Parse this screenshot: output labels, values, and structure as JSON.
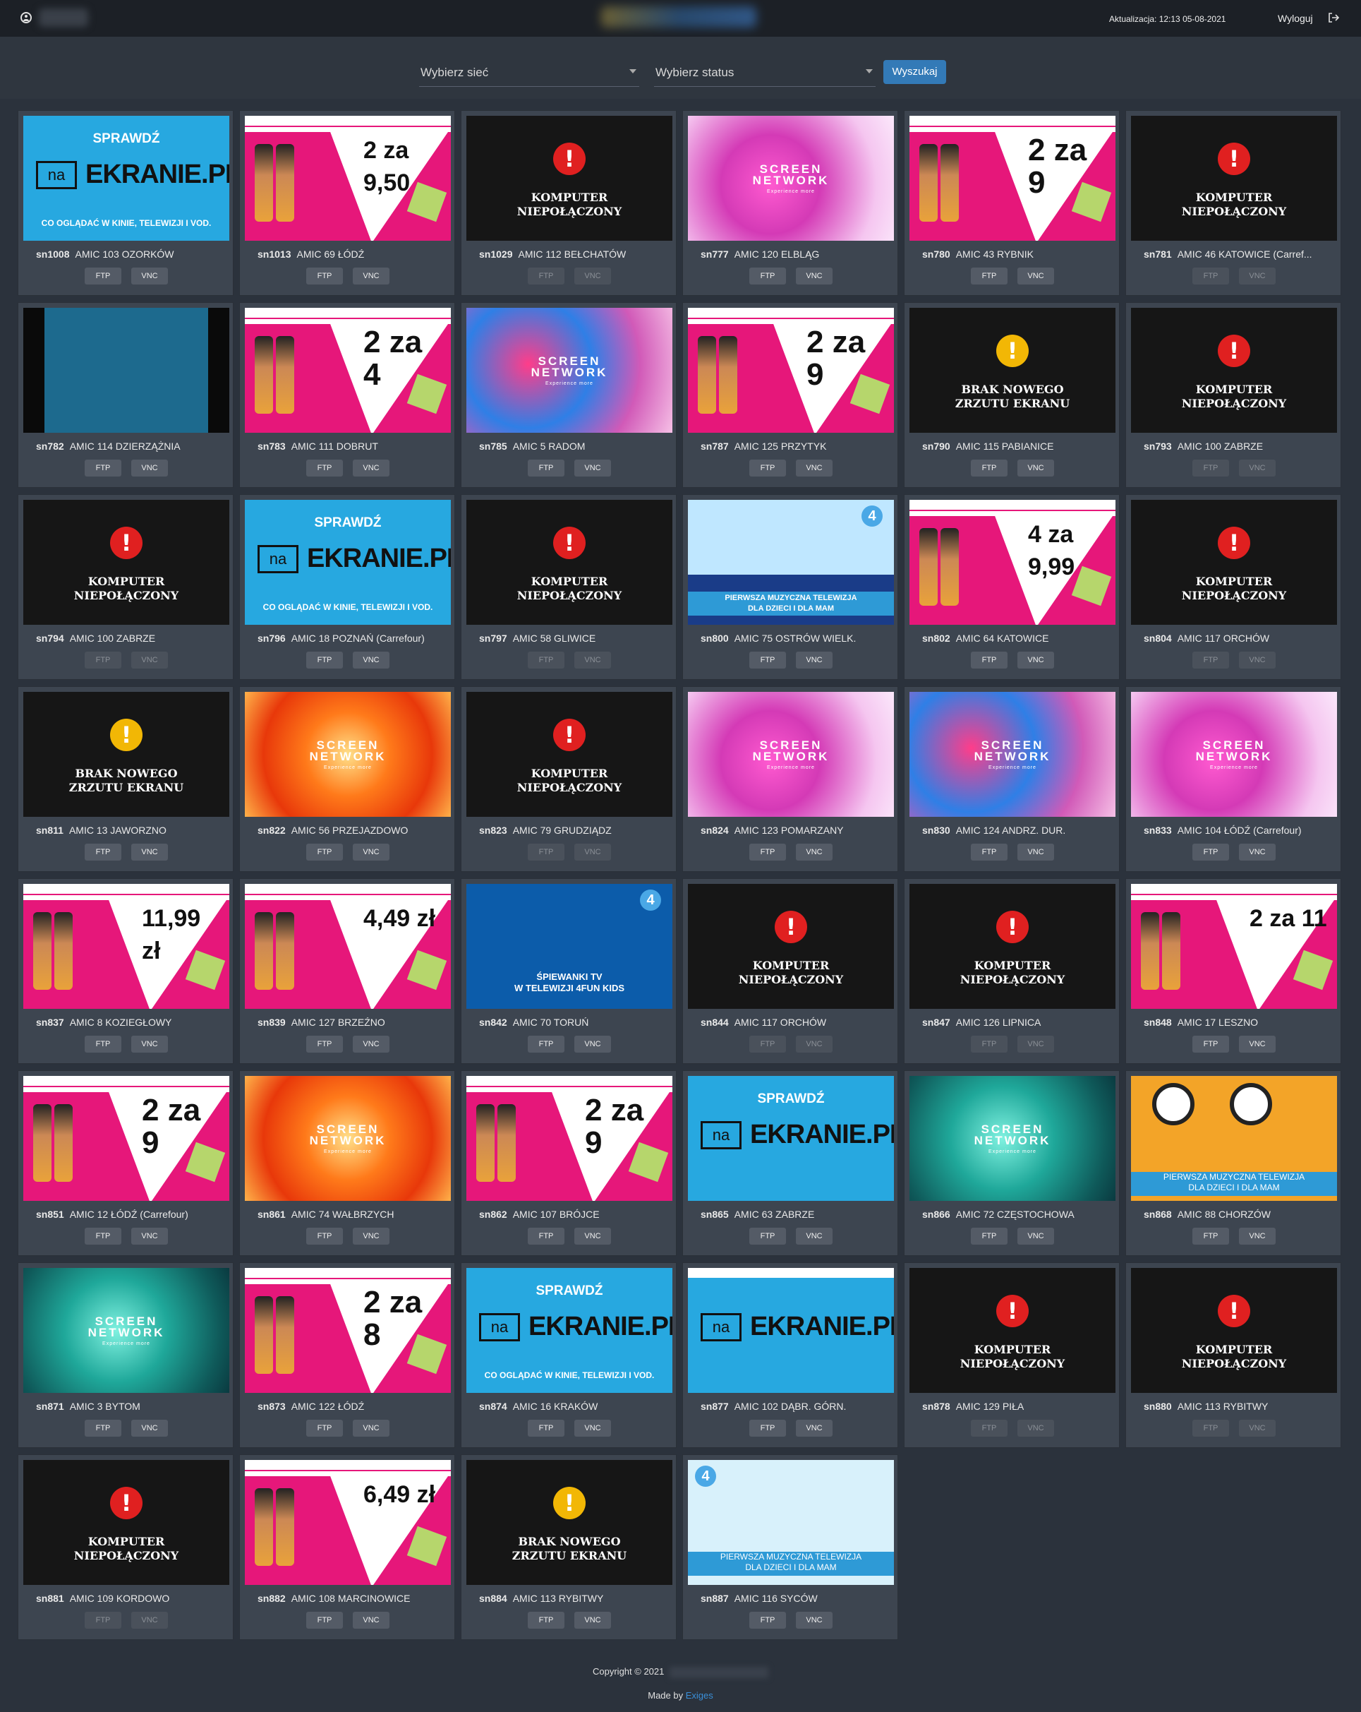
{
  "header": {
    "update_label": "Aktualizacja: 12:13 05-08-2021",
    "logout_label": "Wyloguj"
  },
  "filters": {
    "network_placeholder": "Wybierz sieć",
    "status_placeholder": "Wybierz status",
    "search_label": "Wyszukaj"
  },
  "buttons": {
    "ftp": "FTP",
    "vnc": "VNC"
  },
  "thumb_texts": {
    "disconnected": [
      "KOMPUTER",
      "NIEPOŁĄCZONY"
    ],
    "no_screenshot": [
      "BRAK NOWEGO",
      "ZRZUTU EKRANU"
    ],
    "ekranie_top": "SPRAWDŹ",
    "ekranie_na": "na",
    "ekranie_main": "EKRANIE.PL",
    "ekranie_bottom": "CO OGLĄDAĆ W KINIE, TELEWIZJI I VOD.",
    "screen_network": "SCREEN",
    "screen_network2": "NETWORK",
    "screen_network3": "Experience more",
    "fun_music": [
      "PIERWSZA MUZYCZNA TELEWIZJA",
      "DLA DZIECI I DLA MAM"
    ],
    "fun_songs": [
      "ŚPIEWANKI TV",
      "W TELEWIZJI 4FUN KIDS"
    ],
    "exclaim": "!",
    "four": "4"
  },
  "screens": [
    {
      "id": "sn1008",
      "name": "AMIC 103 OZORKÓW",
      "thumb": "ekranie",
      "dim": false
    },
    {
      "id": "sn1013",
      "name": "AMIC 69 ŁÓDŹ",
      "thumb": "promo",
      "dim": false,
      "promo": "2 za 9,50"
    },
    {
      "id": "sn1029",
      "name": "AMIC 112 BEŁCHATÓW",
      "thumb": "disconnected",
      "dim": true
    },
    {
      "id": "sn777",
      "name": "AMIC 120 ELBLĄG",
      "thumb": "smoke-pink",
      "dim": false
    },
    {
      "id": "sn780",
      "name": "AMIC 43 RYBNIK",
      "thumb": "promo",
      "dim": false,
      "promo": "2 za 9"
    },
    {
      "id": "sn781",
      "name": "AMIC 46 KATOWICE (Carref...",
      "thumb": "disconnected",
      "dim": true
    },
    {
      "id": "sn782",
      "name": "AMIC 114 DZIERZĄŻNIA",
      "thumb": "dark",
      "dim": false
    },
    {
      "id": "sn783",
      "name": "AMIC 111 DOBRUT",
      "thumb": "promo",
      "dim": false,
      "promo": "2 za 4"
    },
    {
      "id": "sn785",
      "name": "AMIC 5 RADOM",
      "thumb": "smoke-blue",
      "dim": false
    },
    {
      "id": "sn787",
      "name": "AMIC 125 PRZYTYK",
      "thumb": "promo",
      "dim": false,
      "promo": "2 za 9"
    },
    {
      "id": "sn790",
      "name": "AMIC 115 PABIANICE",
      "thumb": "noshot",
      "dim": false
    },
    {
      "id": "sn793",
      "name": "AMIC 100 ZABRZE",
      "thumb": "disconnected",
      "dim": true
    },
    {
      "id": "sn794",
      "name": "AMIC 100 ZABRZE",
      "thumb": "disconnected",
      "dim": true
    },
    {
      "id": "sn796",
      "name": "AMIC 18 POZNAŃ (Carrefour)",
      "thumb": "ekranie",
      "dim": false
    },
    {
      "id": "sn797",
      "name": "AMIC 58 GLIWICE",
      "thumb": "disconnected",
      "dim": true
    },
    {
      "id": "sn800",
      "name": "AMIC 75 OSTRÓW WIELK.",
      "thumb": "4fun-sea",
      "dim": false
    },
    {
      "id": "sn802",
      "name": "AMIC 64 KATOWICE",
      "thumb": "promo",
      "dim": false,
      "promo": "4 za 9,99"
    },
    {
      "id": "sn804",
      "name": "AMIC 117 ORCHÓW",
      "thumb": "disconnected",
      "dim": true
    },
    {
      "id": "sn811",
      "name": "AMIC 13 JAWORZNO",
      "thumb": "noshot",
      "dim": false
    },
    {
      "id": "sn822",
      "name": "AMIC 56 PRZEJAZDOWO",
      "thumb": "smoke-orange",
      "dim": false
    },
    {
      "id": "sn823",
      "name": "AMIC 79 GRUDZIĄDZ",
      "thumb": "disconnected",
      "dim": true
    },
    {
      "id": "sn824",
      "name": "AMIC 123 POMARZANY",
      "thumb": "smoke-pink",
      "dim": false
    },
    {
      "id": "sn830",
      "name": "AMIC 124 ANDRZ. DUR.",
      "thumb": "smoke-blue",
      "dim": false
    },
    {
      "id": "sn833",
      "name": "AMIC 104 ŁÓDŹ (Carrefour)",
      "thumb": "smoke-pink",
      "dim": false
    },
    {
      "id": "sn837",
      "name": "AMIC 8 KOZIEGŁOWY",
      "thumb": "promo",
      "dim": false,
      "promo": "11,99 zł"
    },
    {
      "id": "sn839",
      "name": "AMIC 127 BRZEŹNO",
      "thumb": "promo",
      "dim": false,
      "promo": "4,49 zł"
    },
    {
      "id": "sn842",
      "name": "AMIC 70 TORUŃ",
      "thumb": "4fun-under",
      "dim": false
    },
    {
      "id": "sn844",
      "name": "AMIC 117 ORCHÓW",
      "thumb": "disconnected",
      "dim": true
    },
    {
      "id": "sn847",
      "name": "AMIC 126 LIPNICA",
      "thumb": "disconnected",
      "dim": true
    },
    {
      "id": "sn848",
      "name": "AMIC 17 LESZNO",
      "thumb": "promo",
      "dim": false,
      "promo": "2 za 11"
    },
    {
      "id": "sn851",
      "name": "AMIC 12 ŁÓDŹ (Carrefour)",
      "thumb": "promo",
      "dim": false,
      "promo": "2 za 9"
    },
    {
      "id": "sn861",
      "name": "AMIC 74 WAŁBRZYCH",
      "thumb": "smoke-orange",
      "dim": false
    },
    {
      "id": "sn862",
      "name": "AMIC 107 BRÓJCE",
      "thumb": "promo",
      "dim": false,
      "promo": "2 za 9"
    },
    {
      "id": "sn865",
      "name": "AMIC 63 ZABRZE",
      "thumb": "ekranie-nobottom",
      "dim": false
    },
    {
      "id": "sn866",
      "name": "AMIC 72 CZĘSTOCHOWA",
      "thumb": "smoke-teal",
      "dim": false
    },
    {
      "id": "sn868",
      "name": "AMIC 88 CHORZÓW",
      "thumb": "4fun-yellow",
      "dim": false
    },
    {
      "id": "sn871",
      "name": "AMIC 3 BYTOM",
      "thumb": "smoke-teal",
      "dim": false
    },
    {
      "id": "sn873",
      "name": "AMIC 122 ŁÓDŹ",
      "thumb": "promo",
      "dim": false,
      "promo": "2 za 8"
    },
    {
      "id": "sn874",
      "name": "AMIC 16 KRAKÓW",
      "thumb": "ekranie",
      "dim": false
    },
    {
      "id": "sn877",
      "name": "AMIC 102 DĄBR. GÓRN.",
      "thumb": "ekranie-line",
      "dim": false
    },
    {
      "id": "sn878",
      "name": "AMIC 129 PIŁA",
      "thumb": "disconnected",
      "dim": true
    },
    {
      "id": "sn880",
      "name": "AMIC 113 RYBITWY",
      "thumb": "disconnected",
      "dim": true
    },
    {
      "id": "sn881",
      "name": "AMIC 109 KORDOWO",
      "thumb": "disconnected",
      "dim": true
    },
    {
      "id": "sn882",
      "name": "AMIC 108 MARCINOWICE",
      "thumb": "promo",
      "dim": false,
      "promo": "6,49 zł"
    },
    {
      "id": "sn884",
      "name": "AMIC 113 RYBITWY",
      "thumb": "noshot",
      "dim": false
    },
    {
      "id": "sn887",
      "name": "AMIC 116 SYCÓW",
      "thumb": "4fun-karnawal",
      "dim": false
    }
  ],
  "footer": {
    "copyright": "Copyright © 2021",
    "made_by": "Made by",
    "made_by_link": "Exiges"
  },
  "colors": {
    "page_bg": "#2b323c",
    "topbar_bg": "#1c2026",
    "card_bg": "#3d4550",
    "accent": "#337ab7",
    "alert_red": "#e02020",
    "alert_yellow": "#f2b705"
  }
}
